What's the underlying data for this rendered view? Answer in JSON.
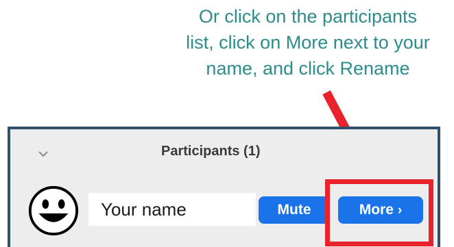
{
  "instruction": {
    "lines": [
      "Or click on the participants",
      "list, click on More next to your",
      "name, and click Rename"
    ],
    "color": "#2e8b8c"
  },
  "panel": {
    "title": "Participants (1)",
    "collapse_icon": "chevron-down-icon",
    "participant": {
      "avatar_icon": "smiley-face-icon",
      "name": "Your name",
      "mute_label": "Mute",
      "more_label": "More",
      "more_icon": "chevron-right-icon"
    },
    "accent_color": "#1a73e8",
    "border_color": "#2f4f6a"
  },
  "annotation": {
    "arrow_color": "#e8232b",
    "highlight_color": "#e8232b"
  }
}
